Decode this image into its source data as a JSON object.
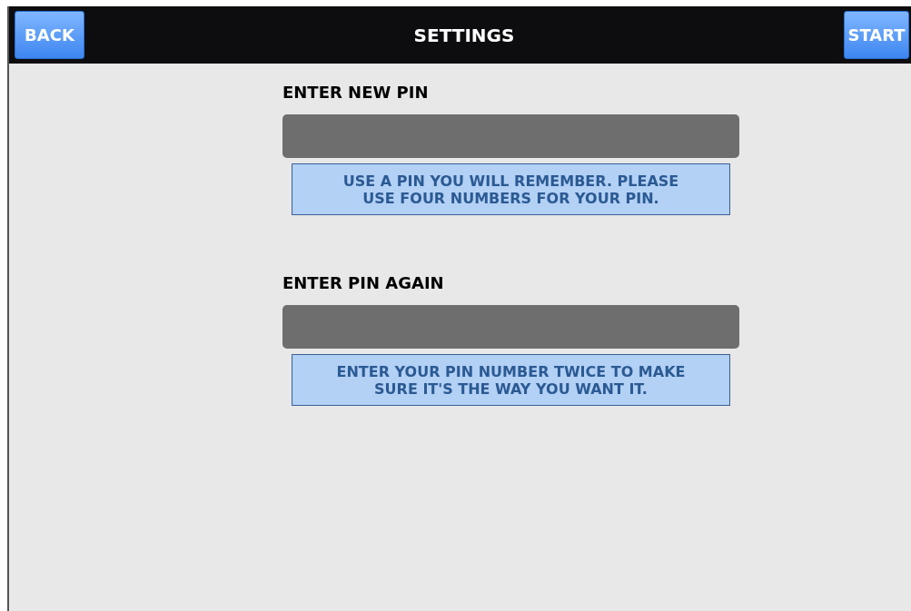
{
  "header": {
    "title": "SETTINGS",
    "back_button": "BACK",
    "start_button": "START"
  },
  "fields": [
    {
      "label": "ENTER NEW PIN",
      "hint": "USE A PIN YOU WILL REMEMBER. PLEASE USE FOUR NUMBERS FOR YOUR PIN."
    },
    {
      "label": "ENTER PIN AGAIN",
      "hint": "ENTER YOUR PIN NUMBER TWICE TO MAKE SURE IT'S THE WAY YOU WANT IT."
    }
  ]
}
